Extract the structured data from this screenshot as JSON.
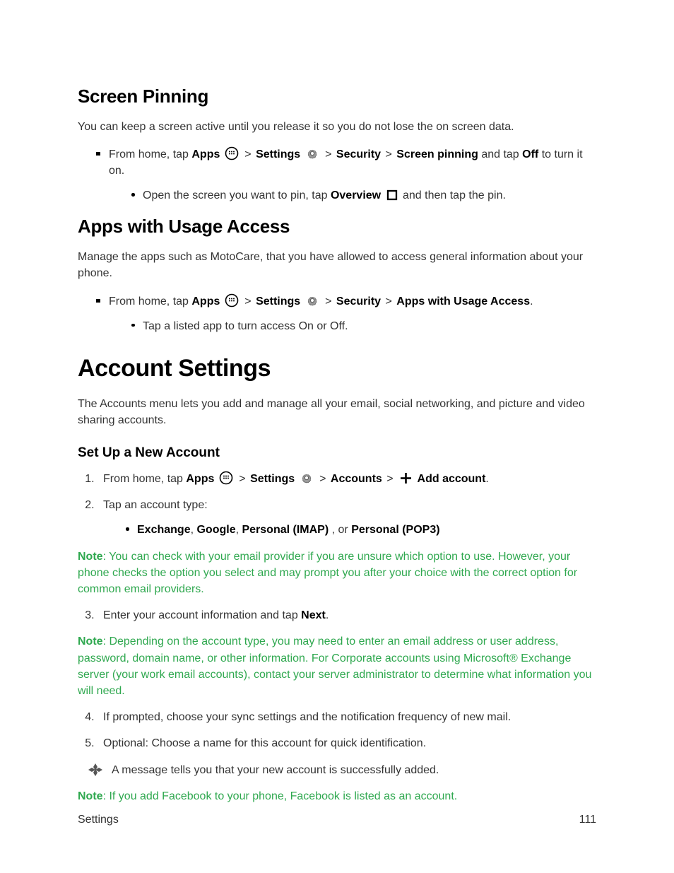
{
  "screenPinning": {
    "heading": "Screen Pinning",
    "intro": "You can keep a screen active until you release it so you do not lose the on screen data.",
    "path": {
      "prefix": "From home, tap ",
      "apps": "Apps",
      "settings": "Settings",
      "security": "Security",
      "screenPinning": "Screen pinning",
      "andTap": " and tap ",
      "off": "Off",
      "suffix": " to turn it on."
    },
    "sub": {
      "prefix": "Open the screen you want to pin, tap ",
      "overview": "Overview",
      "suffix": " and then tap the pin."
    }
  },
  "usageAccess": {
    "heading": "Apps with Usage Access",
    "intro": "Manage the apps such as MotoCare, that you have allowed to access general information about your phone.",
    "path": {
      "prefix": "From home, tap ",
      "apps": "Apps",
      "settings": "Settings",
      "security": "Security",
      "usage": "Apps with Usage Access",
      "suffix": "."
    },
    "sub": "Tap a listed app to turn access On or Off."
  },
  "accountSettings": {
    "heading": "Account Settings",
    "intro": "The Accounts menu lets you add and manage all your email, social networking, and picture and video sharing accounts.",
    "setUpHeading": "Set Up a New Account",
    "step1": {
      "prefix": "From home, tap ",
      "apps": "Apps",
      "settings": "Settings",
      "accounts": "Accounts",
      "addAccount": "Add account",
      "suffix": "."
    },
    "step2": {
      "text": "Tap an account type:",
      "options": {
        "exchange": "Exchange",
        "sep1": ", ",
        "google": "Google",
        "sep2": ", ",
        "imap": "Personal (IMAP)",
        "sep3": " , or  ",
        "pop3": "Personal (POP3)"
      }
    },
    "note1": {
      "label": "Note",
      "text": ": You can check with your email provider if you are unsure which option to use. However, your phone checks the option you select and may prompt you after your choice with the correct option for common email providers."
    },
    "step3": {
      "prefix": "Enter your account information and tap ",
      "next": "Next",
      "suffix": "."
    },
    "note2": {
      "label": "Note",
      "text": ": Depending on the account type, you may need to enter an email address or user address, password, domain name, or other information. For Corporate accounts using Microsoft® Exchange server (your work email accounts), contact your server administrator to determine what information you will need."
    },
    "step4": "If prompted, choose your sync settings and the notification frequency of new mail.",
    "step5": "Optional: Choose a name for this account for quick identification.",
    "diamond": "A message tells you that your new account is successfully added.",
    "note3": {
      "label": "Note",
      "text": ": If you add Facebook to your phone, Facebook is listed as an account."
    }
  },
  "footer": {
    "section": "Settings",
    "page": "111"
  },
  "gt": ">"
}
